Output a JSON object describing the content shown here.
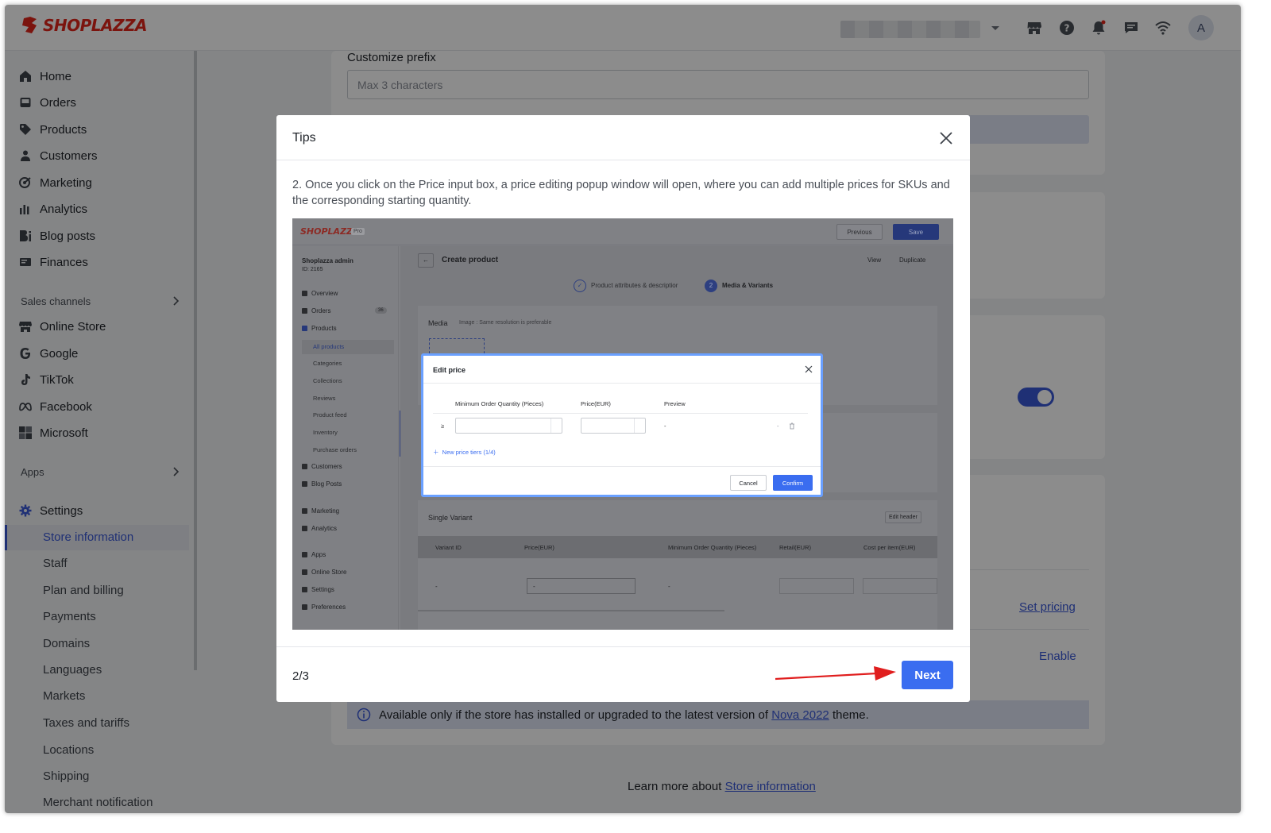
{
  "brand": {
    "name": "SHOPLAZZA",
    "color": "#e1251b"
  },
  "topbar": {
    "avatar_initial": "A",
    "icons": [
      "store-icon",
      "help-icon",
      "bell-icon",
      "chat-icon",
      "wifi-icon"
    ]
  },
  "sidebar": {
    "main_items": [
      {
        "label": "Home",
        "icon": "home-icon"
      },
      {
        "label": "Orders",
        "icon": "orders-icon"
      },
      {
        "label": "Products",
        "icon": "tag-icon"
      },
      {
        "label": "Customers",
        "icon": "person-icon"
      },
      {
        "label": "Marketing",
        "icon": "marketing-icon"
      },
      {
        "label": "Analytics",
        "icon": "analytics-icon"
      },
      {
        "label": "Blog posts",
        "icon": "blog-icon"
      },
      {
        "label": "Finances",
        "icon": "finances-icon"
      }
    ],
    "sales_channels_label": "Sales channels",
    "channels": [
      {
        "label": "Online Store",
        "icon": "store-icon"
      },
      {
        "label": "Google",
        "icon": "google-icon"
      },
      {
        "label": "TikTok",
        "icon": "tiktok-icon"
      },
      {
        "label": "Facebook",
        "icon": "meta-icon"
      },
      {
        "label": "Microsoft",
        "icon": "microsoft-icon"
      }
    ],
    "apps_label": "Apps",
    "settings_label": "Settings",
    "settings_items": [
      "Store information",
      "Staff",
      "Plan and billing",
      "Payments",
      "Domains",
      "Languages",
      "Markets",
      "Taxes and tariffs",
      "Locations",
      "Shipping",
      "Merchant notification"
    ],
    "active_item": "Store information"
  },
  "main": {
    "customize_prefix_label": "Customize prefix",
    "prefix_placeholder": "Max 3 characters",
    "set_pricing": "Set pricing",
    "enable": "Enable",
    "info_text_before": "Available only if the store has installed or upgraded to the latest version of",
    "info_link": "Nova 2022",
    "info_text_after": "theme.",
    "learn_more_text": "Learn more about",
    "learn_more_link": "Store information",
    "accent_color": "#3a58d6"
  },
  "modal": {
    "title": "Tips",
    "description": "2. Once you click on the Price input box, a price editing popup window will open, where you can add multiple prices for SKUs and the corresponding starting quantity.",
    "step": "2/3",
    "next_label": "Next",
    "tip_image": {
      "logo": "SHOPLAZZA",
      "pro_badge": "Pro",
      "previous": "Previous",
      "save": "Save",
      "store_name": "Shoplazza admin",
      "store_id": "ID: 2165",
      "nav": [
        "Overview",
        "Orders",
        "Products"
      ],
      "orders_badge": "36",
      "product_sub": [
        "All products",
        "Categories",
        "Collections",
        "Reviews",
        "Product feed",
        "Inventory",
        "Purchase orders"
      ],
      "nav2": [
        "Customers",
        "Blog Posts",
        "Marketing",
        "Analytics",
        "Apps",
        "Online Store",
        "Settings",
        "Preferences"
      ],
      "page_title": "Create product",
      "view": "View",
      "duplicate": "Duplicate",
      "step1": "Product attributes & descriptior",
      "step2_num": "2",
      "step2": "Media & Variants",
      "media_label": "Media",
      "media_hint": "Image : Same resolution is preferable",
      "single_variant": "Single Variant",
      "edit_header": "Edit header",
      "variant_cols": [
        "Variant ID",
        "Price(EUR)",
        "Minimum Order Quantity (Pieces)",
        "Retail(EUR)",
        "Cost per item(EUR)"
      ],
      "dash": "-",
      "edit_price": {
        "title": "Edit price",
        "col_min_qty": "Minimum Order Quantity (Pieces)",
        "col_price": "Price(EUR)",
        "col_preview": "Preview",
        "geq": "≥",
        "preview_value": "-",
        "new_tiers": "New price tiers  (1/4)",
        "cancel": "Cancel",
        "confirm": "Confirm"
      }
    }
  }
}
